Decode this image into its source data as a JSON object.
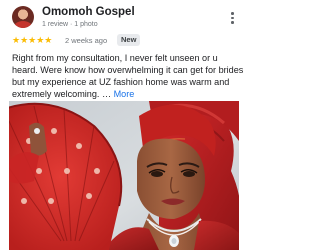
{
  "review": {
    "reviewer_name": "Omomoh Gospel",
    "reviewer_meta": "1 review · 1 photo",
    "menu_icon": "more-vert-icon",
    "rating": 5,
    "stars": "★★★★★",
    "age": "2 weeks ago",
    "badge": "New",
    "text": "Right from my consultation, I never felt unseen or u heard. Were know how overwhelming it can get for brides but my experience at UZ fashion home was warm and extremely welcoming. …",
    "more_label": "More",
    "colors": {
      "star": "#fbbc04",
      "link": "#1a73e8",
      "badge_bg": "#e8eaed"
    }
  }
}
